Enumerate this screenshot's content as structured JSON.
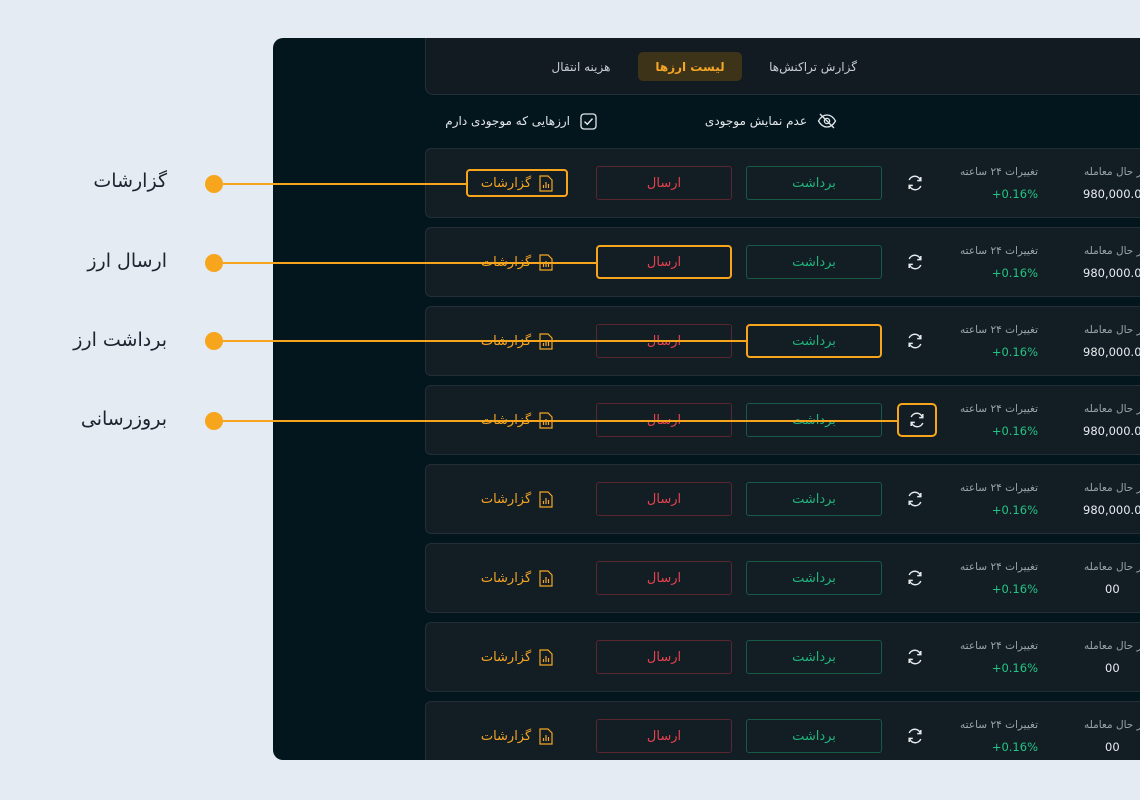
{
  "callouts": [
    {
      "label": "گزارشات"
    },
    {
      "label": "ارسال ارز"
    },
    {
      "label": "برداشت ارز"
    },
    {
      "label": "بروزرسانی"
    }
  ],
  "tabs": [
    {
      "label": "گزارش تراکنش‌ها",
      "active": false
    },
    {
      "label": "لیست ارزها",
      "active": true
    },
    {
      "label": "هزینه انتقال",
      "active": false
    }
  ],
  "filters": {
    "hide_balance": "عدم نمایش موجودی",
    "owned_only": "ارزهایی که موجودی دارم"
  },
  "colors": {
    "accent": "#f5a524",
    "send": "#e4424f",
    "withdraw": "#1fb57c",
    "positive": "#23c483"
  },
  "rows": [
    {
      "trade_label": "در حال معامله",
      "trade_value": "980,000.00",
      "change_label": "تغییرات ۲۴ ساعته",
      "change_value": "+0.16%",
      "withdraw": "برداشت",
      "send": "ارسال",
      "report": "گزارشات"
    },
    {
      "trade_label": "در حال معامله",
      "trade_value": "980,000.00",
      "change_label": "تغییرات ۲۴ ساعته",
      "change_value": "+0.16%",
      "withdraw": "برداشت",
      "send": "ارسال",
      "report": "گزارشات"
    },
    {
      "trade_label": "در حال معامله",
      "trade_value": "980,000.00",
      "change_label": "تغییرات ۲۴ ساعته",
      "change_value": "+0.16%",
      "withdraw": "برداشت",
      "send": "ارسال",
      "report": "گزارشات"
    },
    {
      "trade_label": "در حال معامله",
      "trade_value": "980,000.00",
      "change_label": "تغییرات ۲۴ ساعته",
      "change_value": "+0.16%",
      "withdraw": "برداشت",
      "send": "ارسال",
      "report": "گزارشات"
    },
    {
      "trade_label": "در حال معامله",
      "trade_value": "980,000.00",
      "change_label": "تغییرات ۲۴ ساعته",
      "change_value": "+0.16%",
      "withdraw": "برداشت",
      "send": "ارسال",
      "report": "گزارشات"
    },
    {
      "trade_label": "در حال معامله",
      "trade_value": "00",
      "change_label": "تغییرات ۲۴ ساعته",
      "change_value": "+0.16%",
      "withdraw": "برداشت",
      "send": "ارسال",
      "report": "گزارشات"
    },
    {
      "trade_label": "در حال معامله",
      "trade_value": "00",
      "change_label": "تغییرات ۲۴ ساعته",
      "change_value": "+0.16%",
      "withdraw": "برداشت",
      "send": "ارسال",
      "report": "گزارشات"
    },
    {
      "trade_label": "در حال معامله",
      "trade_value": "00",
      "change_label": "تغییرات ۲۴ ساعته",
      "change_value": "+0.16%",
      "withdraw": "برداشت",
      "send": "ارسال",
      "report": "گزارشات"
    }
  ]
}
